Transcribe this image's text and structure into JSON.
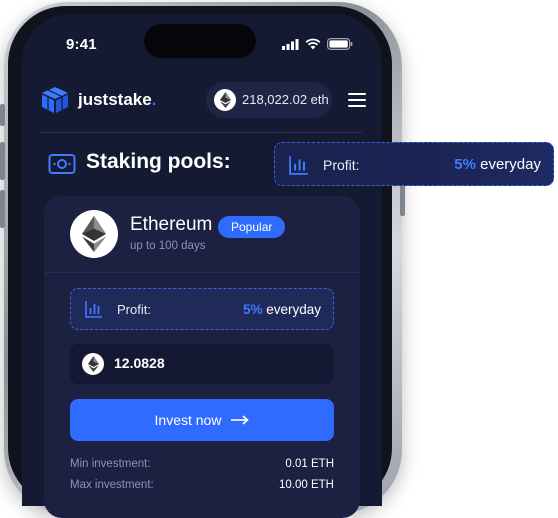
{
  "status_bar": {
    "time": "9:41"
  },
  "header": {
    "brand": "juststake",
    "brand_dot": ".",
    "balance": "218,022.02 eth"
  },
  "section": {
    "title": "Staking pools:"
  },
  "callout": {
    "label": "Profit:",
    "value_pct": "5%",
    "value_text": " everyday"
  },
  "pool_card": {
    "name": "Ethereum",
    "badge": "Popular",
    "subtitle": "up to 100 days",
    "profit_label": "Profit:",
    "profit_pct": "5%",
    "profit_text": " everyday",
    "amount": "12.0828",
    "invest_label": "Invest now",
    "min_label": "Min investment:",
    "min_value": "0.01 ETH",
    "max_label": "Max investment:",
    "max_value": "10.00 ETH"
  },
  "icons": {
    "logo": "cube-logo-icon",
    "eth": "ethereum-icon",
    "menu": "hamburger-menu-icon",
    "pools": "wallet-icon",
    "chart": "bar-chart-icon",
    "arrow": "arrow-right-icon"
  },
  "colors": {
    "accent": "#2f6bff",
    "background": "#151a33",
    "card": "#1c2142"
  }
}
